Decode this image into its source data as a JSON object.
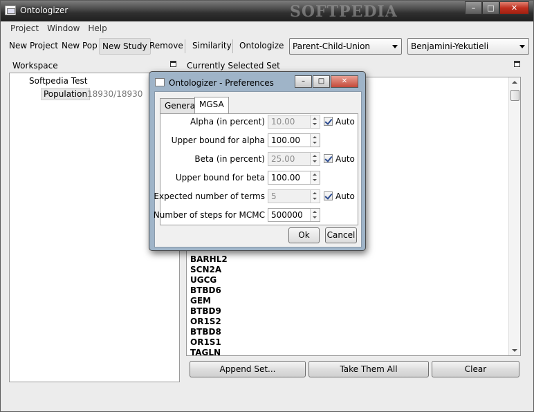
{
  "window": {
    "title": "Ontologizer",
    "watermark": "SOFTPEDIA"
  },
  "menu": [
    "Project",
    "Window",
    "Help"
  ],
  "toolbar": {
    "new_project": "New Project",
    "new_pop": "New Pop",
    "new_study": "New Study",
    "remove": "Remove",
    "similarity": "Similarity",
    "ontologize": "Ontologize",
    "method_selected": "Parent-Child-Union",
    "correction_selected": "Benjamini-Yekutieli"
  },
  "workspace": {
    "header": "Workspace",
    "project": "Softpedia Test",
    "population_label": "Population",
    "population_count": "18930/18930"
  },
  "selected_set": {
    "header": "Currently Selected Set",
    "genes": [
      "BARHL2",
      "SCN2A",
      "UGCG",
      "BTBD6",
      "GEM",
      "BTBD9",
      "OR1S2",
      "BTBD8",
      "OR1S1",
      "TAGLN"
    ],
    "append_button": "Append Set...",
    "take_all_button": "Take Them All",
    "clear_button": "Clear"
  },
  "dialog": {
    "title": "Ontologizer - Preferences",
    "tabs": [
      "General",
      "MGSA"
    ],
    "active_tab": "MGSA",
    "fields": [
      {
        "label": "Alpha (in percent)",
        "value": "10.00",
        "disabled": true,
        "auto": true,
        "auto_label": "Auto"
      },
      {
        "label": "Upper bound for alpha",
        "value": "100.00",
        "disabled": false
      },
      {
        "label": "Beta (in percent)",
        "value": "25.00",
        "disabled": true,
        "auto": true,
        "auto_label": "Auto"
      },
      {
        "label": "Upper bound for beta",
        "value": "100.00",
        "disabled": false
      },
      {
        "label": "Expected number of terms",
        "value": "5",
        "disabled": true,
        "auto": true,
        "auto_label": "Auto"
      },
      {
        "label": "Number of steps for MCMC",
        "value": "500000",
        "disabled": false
      }
    ],
    "ok": "Ok",
    "cancel": "Cancel"
  }
}
